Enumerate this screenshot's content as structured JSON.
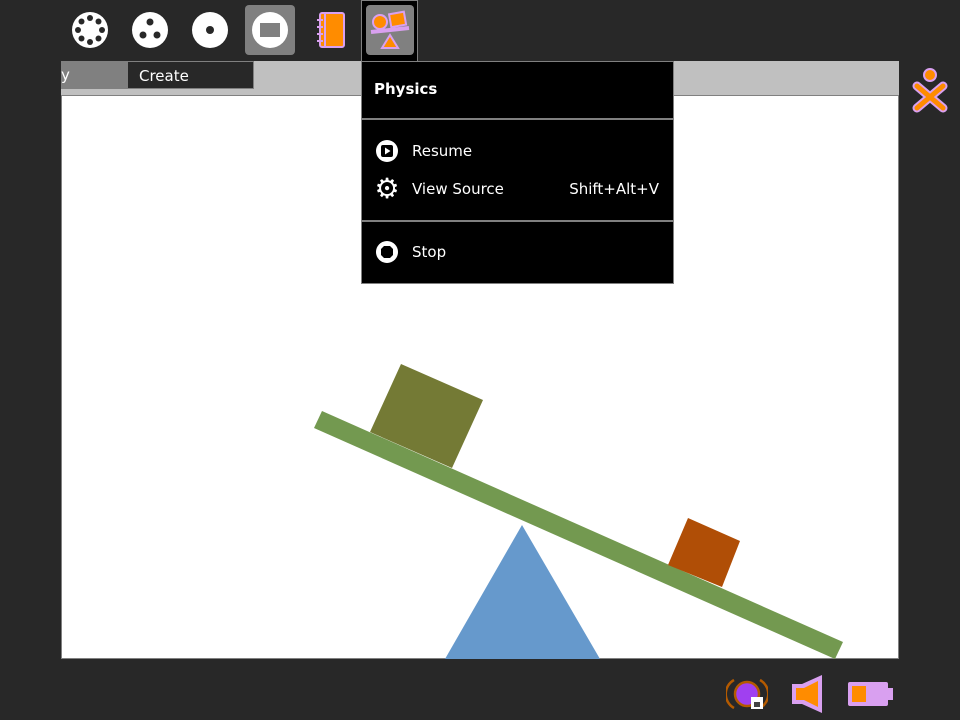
{
  "toolbar": {
    "icons": [
      "neighborhood-icon",
      "group-icon",
      "home-icon",
      "activity-icon",
      "journal-icon",
      "physics-activity-icon"
    ]
  },
  "tabs": [
    {
      "label": "y"
    },
    {
      "label": "Create"
    }
  ],
  "menu": {
    "title": "Physics",
    "items": [
      {
        "label": "Resume",
        "icon": "resume-icon"
      },
      {
        "label": "View Source",
        "icon": "gear-icon",
        "shortcut": "Shift+Alt+V"
      },
      {
        "label": "Stop",
        "icon": "stop-icon"
      }
    ]
  },
  "colors": {
    "plank": "#739950",
    "fulcrum": "#6699cc",
    "big_box": "#747a35",
    "small_box": "#b04e06",
    "accent_orange": "#ff8c00",
    "accent_purple": "#d9a0f0"
  }
}
